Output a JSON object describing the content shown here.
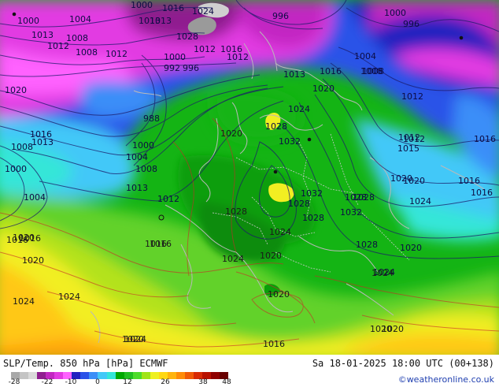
{
  "map": {
    "title": "SLP/Temp. 850 hPa [hPa] ECMWF",
    "run_time": "Sa 18-01-2025 18:00 UTC (00+138)",
    "credit": "©weatheronline.co.uk",
    "colorbar": {
      "tick_labels": [
        "-28",
        "-22",
        "-10",
        "0",
        "12",
        "26",
        "38",
        "48"
      ],
      "colors": [
        "#a8a8a8",
        "#c4c4c4",
        "#dadada",
        "#8f1f8f",
        "#c227c2",
        "#e23be2",
        "#ff62ff",
        "#2020c0",
        "#2a52e8",
        "#3a8ef8",
        "#42c8f8",
        "#34e6d8",
        "#00a800",
        "#20c020",
        "#4cdc2a",
        "#a0e418",
        "#eef020",
        "#ffd814",
        "#ffb40e",
        "#ff8c08",
        "#f05a06",
        "#d82a04",
        "#b81000",
        "#900000",
        "#680000"
      ]
    },
    "isobars": [
      {
        "label": "1000",
        "tone": "cold"
      },
      {
        "label": "1004",
        "tone": "cold"
      },
      {
        "label": "1008",
        "tone": "cold"
      },
      {
        "label": "1013",
        "tone": "cold"
      },
      {
        "label": "1012",
        "tone": "cold"
      },
      {
        "label": "1020",
        "tone": "cold"
      },
      {
        "label": "1016",
        "tone": "cold"
      },
      {
        "label": "1013",
        "tone": "cold"
      },
      {
        "label": "1008",
        "tone": "cold"
      },
      {
        "label": "1000",
        "tone": "cold"
      },
      {
        "label": "1004",
        "tone": "cold"
      },
      {
        "label": "1016",
        "tone": "warm"
      },
      {
        "label": "1020",
        "tone": "warm"
      },
      {
        "label": "1024",
        "tone": "warm"
      },
      {
        "label": "1024",
        "tone": "warm"
      },
      {
        "label": "1000",
        "tone": "cold"
      },
      {
        "label": "1016",
        "tone": "cold"
      },
      {
        "label": "1013",
        "tone": "cold"
      },
      {
        "label": "1024",
        "tone": "cold"
      },
      {
        "label": "1028",
        "tone": "cold"
      },
      {
        "label": "1012",
        "tone": "cold"
      },
      {
        "label": "1008",
        "tone": "cold"
      },
      {
        "label": "1000",
        "tone": "cold"
      },
      {
        "label": "992",
        "tone": "cold"
      },
      {
        "label": "996",
        "tone": "cold"
      },
      {
        "label": "988",
        "tone": "cold"
      },
      {
        "label": "1000",
        "tone": "cold"
      },
      {
        "label": "1004",
        "tone": "cold"
      },
      {
        "label": "1008",
        "tone": "cold"
      },
      {
        "label": "1013",
        "tone": "cold"
      },
      {
        "label": "1012",
        "tone": "cold"
      },
      {
        "label": "1016",
        "tone": "warm"
      },
      {
        "label": "1020",
        "tone": "warm"
      },
      {
        "label": "1024",
        "tone": "warm"
      },
      {
        "label": "1020",
        "tone": "warm"
      },
      {
        "label": "1028",
        "tone": "warm"
      },
      {
        "label": "1012",
        "tone": "cold"
      },
      {
        "label": "1016",
        "tone": "cold"
      },
      {
        "label": "1012",
        "tone": "cold"
      },
      {
        "label": "1013",
        "tone": "cold"
      },
      {
        "label": "996",
        "tone": "cold"
      },
      {
        "label": "1013",
        "tone": "cold"
      },
      {
        "label": "1016",
        "tone": "cold"
      },
      {
        "label": "1008",
        "tone": "cold"
      },
      {
        "label": "1024",
        "tone": "cold"
      },
      {
        "label": "1028",
        "tone": "cold"
      },
      {
        "label": "1032",
        "tone": "cold"
      },
      {
        "label": "1020",
        "tone": "cold"
      },
      {
        "label": "1032",
        "tone": "cold"
      },
      {
        "label": "1028",
        "tone": "cold"
      },
      {
        "label": "1028",
        "tone": "cold"
      },
      {
        "label": "1024",
        "tone": "warm"
      },
      {
        "label": "1020",
        "tone": "warm"
      },
      {
        "label": "1016",
        "tone": "warm"
      },
      {
        "label": "1020",
        "tone": "warm"
      },
      {
        "label": "1028",
        "tone": "cold"
      },
      {
        "label": "1032",
        "tone": "cold"
      },
      {
        "label": "1028",
        "tone": "cold"
      },
      {
        "label": "1020",
        "tone": "cold"
      },
      {
        "label": "1024",
        "tone": "cold"
      },
      {
        "label": "1020",
        "tone": "warm"
      },
      {
        "label": "1024",
        "tone": "warm"
      },
      {
        "label": "1020",
        "tone": "warm"
      },
      {
        "label": "1000",
        "tone": "cold"
      },
      {
        "label": "996",
        "tone": "cold"
      },
      {
        "label": "1004",
        "tone": "cold"
      },
      {
        "label": "1008",
        "tone": "cold"
      },
      {
        "label": "1012",
        "tone": "cold"
      },
      {
        "label": "1016",
        "tone": "cold"
      },
      {
        "label": "1012",
        "tone": "cold"
      },
      {
        "label": "1016",
        "tone": "cold"
      },
      {
        "label": "1015",
        "tone": "cold"
      },
      {
        "label": "1020",
        "tone": "cold"
      },
      {
        "label": "1024",
        "tone": "cold"
      },
      {
        "label": "1028",
        "tone": "cold"
      },
      {
        "label": "1016",
        "tone": "cold"
      },
      {
        "label": "1012",
        "tone": "cold"
      },
      {
        "label": "1020",
        "tone": "cold"
      },
      {
        "label": "1024",
        "tone": "warm"
      },
      {
        "label": "1020",
        "tone": "warm"
      },
      {
        "label": "1016",
        "tone": "warm"
      },
      {
        "label": "1016",
        "tone": "warm"
      }
    ]
  }
}
